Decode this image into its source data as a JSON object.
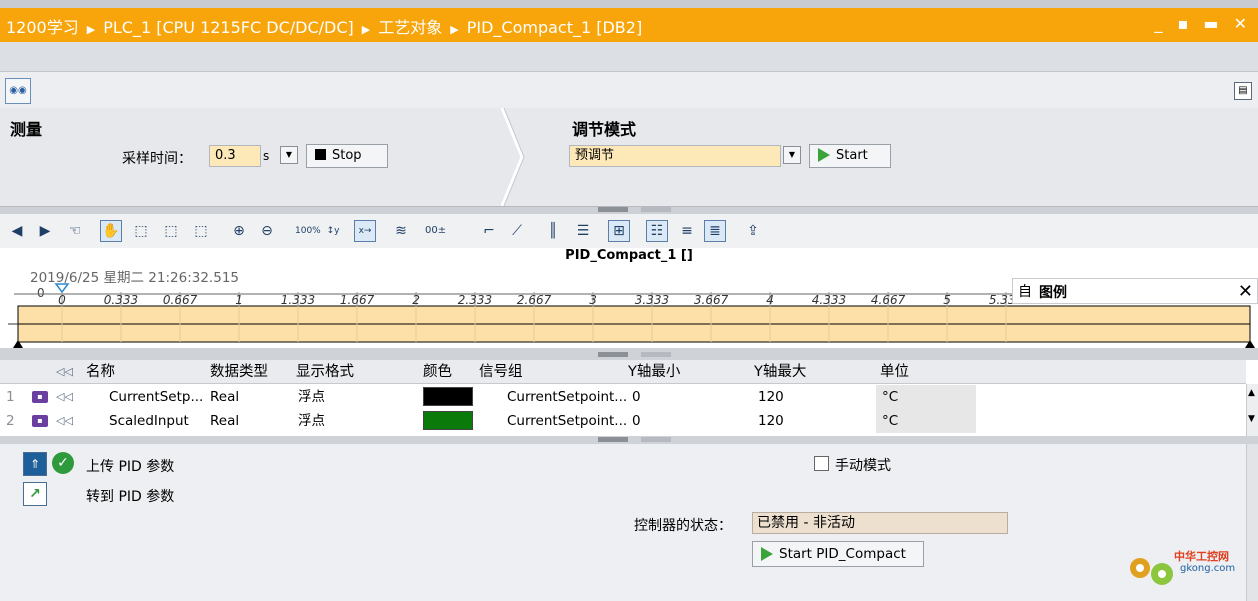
{
  "window": {
    "breadcrumb": [
      "1200学习",
      "PLC_1 [CPU 1215FC DC/DC/DC]",
      "工艺对象",
      "PID_Compact_1 [DB2]"
    ],
    "controls": "_ ▪ ▬ ✕"
  },
  "measure": {
    "title": "测量",
    "sample_label": "采样时间：",
    "sample_value": "0.3",
    "sample_unit": "s",
    "stop_label": "Stop"
  },
  "tuning": {
    "title": "调节模式",
    "mode_value": "预调节",
    "start_label": "Start"
  },
  "chart": {
    "title": "PID_Compact_1 []",
    "timestamp": "2019/6/25 星期二 21:26:32.515",
    "y_tick": "0",
    "legend_title": "图例",
    "legend_auto": "自",
    "legend_close": "✕"
  },
  "chart_data": {
    "type": "line",
    "x_ticks": [
      "0",
      "0.333",
      "0.667",
      "1",
      "1.333",
      "1.667",
      "2",
      "2.333",
      "2.667",
      "3",
      "3.333",
      "3.667",
      "4",
      "4.333",
      "4.667",
      "5",
      "5.333"
    ],
    "xlim": [
      0,
      5.4
    ]
  },
  "table": {
    "headers": [
      "名称",
      "数据类型",
      "显示格式",
      "颜色",
      "信号组",
      "Y轴最小",
      "Y轴最大",
      "单位"
    ],
    "rows": [
      {
        "num": "1",
        "name": "CurrentSetp...",
        "type": "Real",
        "format": "浮点",
        "color": "#000000",
        "group": "CurrentSetpoint...",
        "ymin": "0",
        "ymax": "120",
        "unit": "°C"
      },
      {
        "num": "2",
        "name": "ScaledInput",
        "type": "Real",
        "format": "浮点",
        "color": "#0a7a0a",
        "group": "CurrentSetpoint...",
        "ymin": "0",
        "ymax": "120",
        "unit": "°C"
      }
    ]
  },
  "bottom": {
    "upload_label": "上传 PID 参数",
    "goto_label": "转到 PID 参数",
    "manual_label": "手动模式",
    "status_label": "控制器的状态：",
    "status_value": "已禁用 - 非活动",
    "start_pid_label": "Start PID_Compact"
  },
  "logo": {
    "text_cn": "中华工控网",
    "text_en": "gkong.com"
  },
  "colors": {
    "title_bar": "#f7a50a",
    "highlight_fill": "#fde0a8",
    "series_1": "#000000",
    "series_2": "#0a7a0a"
  }
}
